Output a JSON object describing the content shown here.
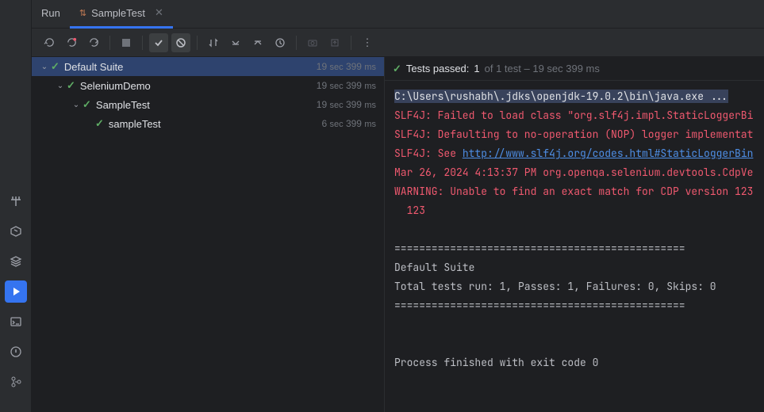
{
  "tabs": {
    "run": "Run",
    "active_icon": "⇅",
    "active_label": "SampleTest"
  },
  "tree": {
    "rows": [
      {
        "label": "Default Suite",
        "t1": "19",
        "u1": "sec",
        "t2": "399",
        "u2": "ms"
      },
      {
        "label": "SeleniumDemo",
        "t1": "19",
        "u1": "sec",
        "t2": "399",
        "u2": "ms"
      },
      {
        "label": "SampleTest",
        "t1": "19",
        "u1": "sec",
        "t2": "399",
        "u2": "ms"
      },
      {
        "label": "sampleTest",
        "t1": "6",
        "u1": "sec",
        "t2": "399",
        "u2": "ms"
      }
    ]
  },
  "status": {
    "label": "Tests passed:",
    "count": "1",
    "rest": "of 1 test – 19 sec 399 ms"
  },
  "console": {
    "cmd": "C:\\Users\\rushabh\\.jdks\\openjdk-19.0.2\\bin\\java.exe ...",
    "l1": "SLF4J: Failed to load class \"org.slf4j.impl.StaticLoggerBi",
    "l2": "SLF4J: Defaulting to no-operation (NOP) logger implementat",
    "l3a": "SLF4J: See ",
    "l3b": "http://www.slf4j.org/codes.html#StaticLoggerBin",
    "l4": "Mar 26, 2024 4:13:37 PM org.openqa.selenium.devtools.CdpVe",
    "l5": "WARNING: Unable to find an exact match for CDP version 123",
    "l6": "  123",
    "sep": "===============================================",
    "suite": "Default Suite",
    "totals": "Total tests run: 1, Passes: 1, Failures: 0, Skips: 0",
    "exit": "Process finished with exit code 0"
  }
}
